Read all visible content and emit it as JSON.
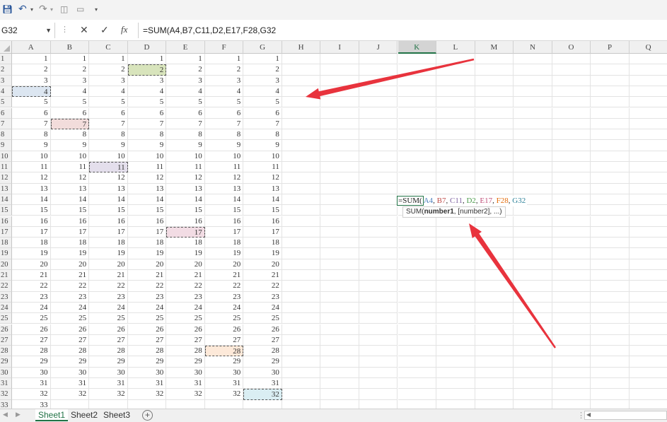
{
  "qat": {
    "save_icon": "save-icon",
    "undo_icon": "undo-icon",
    "redo_icon": "redo-icon",
    "print_preview_icon": "print-preview-icon",
    "screen_icon": "screen-icon",
    "customize_icon": "customize-icon"
  },
  "formula_bar": {
    "name_box": "G32",
    "formula": "=SUM(A4,B7,C11,D2,E17,F28,G32"
  },
  "grid": {
    "columns": [
      "A",
      "B",
      "C",
      "D",
      "E",
      "F",
      "G",
      "H",
      "I",
      "J",
      "K",
      "L",
      "M",
      "N",
      "O",
      "P",
      "Q"
    ],
    "active_column": "K",
    "rows": [
      "1",
      "2",
      "3",
      "4",
      "5",
      "6",
      "7",
      "8",
      "9",
      "10",
      "11",
      "12",
      "13",
      "14",
      "15",
      "16",
      "17",
      "18",
      "19",
      "20",
      "21",
      "22",
      "23",
      "24",
      "25",
      "26",
      "27",
      "28",
      "29",
      "30",
      "31",
      "32",
      "33"
    ],
    "highlighted_refs": [
      {
        "ref": "A4",
        "color": "#dce6f1"
      },
      {
        "ref": "B7",
        "color": "#f2dcdb"
      },
      {
        "ref": "C11",
        "color": "#e4dfec"
      },
      {
        "ref": "D2",
        "color": "#d8e4bc"
      },
      {
        "ref": "E17",
        "color": "#f2dce4"
      },
      {
        "ref": "F28",
        "color": "#fde9d9"
      },
      {
        "ref": "G32",
        "color": "#daeef3"
      }
    ]
  },
  "in_cell_formula": {
    "prefix": "=SUM(",
    "args": [
      {
        "text": "A4",
        "color": "#4f81bd"
      },
      {
        "text": ", ",
        "color": "#333333"
      },
      {
        "text": "B7",
        "color": "#c0504d"
      },
      {
        "text": ", ",
        "color": "#333333"
      },
      {
        "text": "C11",
        "color": "#8064a2"
      },
      {
        "text": ", ",
        "color": "#333333"
      },
      {
        "text": "D2",
        "color": "#4f9d4f"
      },
      {
        "text": ", ",
        "color": "#333333"
      },
      {
        "text": "E17",
        "color": "#c0507a"
      },
      {
        "text": ", ",
        "color": "#333333"
      },
      {
        "text": "F28",
        "color": "#e46c0a"
      },
      {
        "text": ", ",
        "color": "#333333"
      },
      {
        "text": "G32",
        "color": "#31849b"
      }
    ]
  },
  "tooltip": {
    "fn": "SUM(",
    "arg1": "number1",
    "rest": ", [number2], ...)"
  },
  "sheets": {
    "tabs": [
      {
        "label": "Sheet1",
        "active": true
      },
      {
        "label": "Sheet2",
        "active": false
      },
      {
        "label": "Sheet3",
        "active": false
      }
    ],
    "add_label": "+"
  },
  "annotation_color": "#e8333d"
}
